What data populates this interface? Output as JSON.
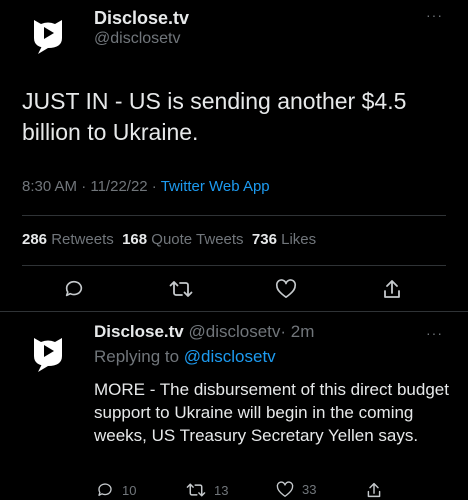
{
  "colors": {
    "background": "#000000",
    "text": "#e7e9ea",
    "muted": "#71767b",
    "accent": "#1d9bf0",
    "divider": "#2f3336"
  },
  "main_tweet": {
    "display_name": "Disclose.tv",
    "handle": "@disclosetv",
    "text": "JUST IN - US is sending another $4.5 billion to Ukraine.",
    "time": "8:30 AM · 11/22/22 · ",
    "source": "Twitter Web App",
    "stats": {
      "retweets_count": "286",
      "retweets_label": "Retweets",
      "quotes_count": "168",
      "quotes_label": "Quote Tweets",
      "likes_count": "736",
      "likes_label": "Likes"
    },
    "more_icon": "more-icon"
  },
  "reply_tweet": {
    "display_name": "Disclose.tv",
    "handle": "@disclosetv",
    "time": "· 2m",
    "replying_to_label": "Replying to ",
    "replying_to_handle": "@disclosetv",
    "text": "MORE - The disbursement of this direct budget support to Ukraine will begin in the coming weeks, US Treasury Secretary Yellen says.",
    "reply_count": "10",
    "retweet_count": "13",
    "like_count": "33"
  }
}
